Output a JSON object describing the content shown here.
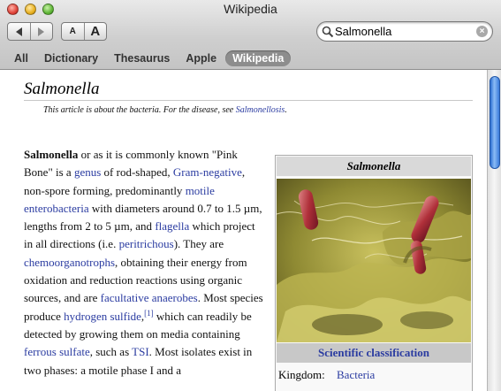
{
  "window": {
    "title": "Wikipedia"
  },
  "toolbar": {
    "font_small_label": "A",
    "font_large_label": "A",
    "search_value": "Salmonella",
    "clear_label": "×"
  },
  "scopes": [
    {
      "label": "All",
      "active": false
    },
    {
      "label": "Dictionary",
      "active": false
    },
    {
      "label": "Thesaurus",
      "active": false
    },
    {
      "label": "Apple",
      "active": false
    },
    {
      "label": "Wikipedia",
      "active": true
    }
  ],
  "article": {
    "title": "Salmonella",
    "hatnote_text": "This article is about the bacteria. For the disease, see ",
    "hatnote_link": "Salmonellosis",
    "hatnote_end": ".",
    "paragraph": [
      {
        "t": "Salmonella",
        "b": true
      },
      {
        "t": " or as it is commonly known \"Pink Bone\" is a "
      },
      {
        "t": "genus",
        "link": true
      },
      {
        "t": " of rod-shaped, "
      },
      {
        "t": "Gram-negative",
        "link": true
      },
      {
        "t": ", non-spore forming, predominantly "
      },
      {
        "t": "motile enterobacteria",
        "link": true
      },
      {
        "t": " with diameters around 0.7 to 1.5 µm, lengths from 2 to 5 µm, and "
      },
      {
        "t": "flagella",
        "link": true
      },
      {
        "t": " which project in all directions (i.e. "
      },
      {
        "t": "peritrichous",
        "link": true
      },
      {
        "t": "). They are "
      },
      {
        "t": "chemoorganotrophs",
        "link": true
      },
      {
        "t": ", obtaining their energy from oxidation and reduction reactions using organic sources, and are "
      },
      {
        "t": "facultative anaerobes",
        "link": true
      },
      {
        "t": ". Most species produce "
      },
      {
        "t": "hydrogen sulfide",
        "link": true
      },
      {
        "t": ",",
        "after_sup": false
      },
      {
        "t": "[1]",
        "link": true,
        "sup": true
      },
      {
        "t": " which can readily be detected by growing them on media containing "
      },
      {
        "t": "ferrous sulfate",
        "link": true
      },
      {
        "t": ", such as "
      },
      {
        "t": "TSI",
        "link": true
      },
      {
        "t": ". Most isolates exist in two phases: a motile phase I and a"
      }
    ]
  },
  "infobox": {
    "title": "Salmonella",
    "classification_header": "Scientific classification",
    "rows": [
      {
        "key": "Kingdom:",
        "value": "Bacteria"
      }
    ]
  },
  "colors": {
    "link": "#2b3ca1",
    "scope_active": "#8d8d8d",
    "scroll_thumb": "#3a7bdc"
  }
}
